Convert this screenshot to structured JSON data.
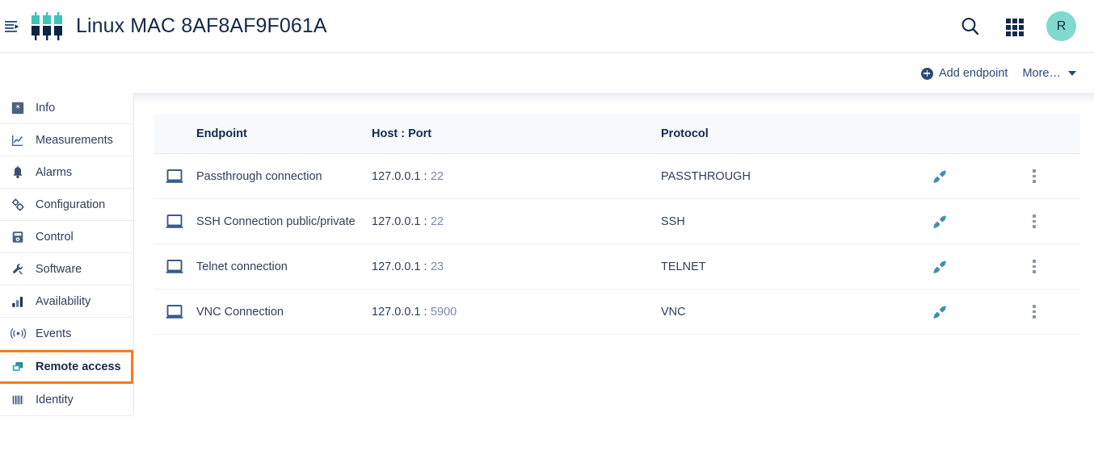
{
  "header": {
    "menu_icon": "hamburger-menu-icon",
    "logo_icon": "server-rack-logo",
    "title": "Linux MAC 8AF8AF9F061A",
    "search_icon": "search-icon",
    "apps_icon": "apps-grid-icon",
    "avatar_initial": "R"
  },
  "toolbar": {
    "add_endpoint_label": "Add endpoint",
    "add_icon": "plus-circle-icon",
    "more_label": "More…",
    "more_caret_icon": "chevron-down-icon"
  },
  "sidebar": {
    "items": [
      {
        "label": "Info",
        "icon": "info-asterisk-icon",
        "active": false
      },
      {
        "label": "Measurements",
        "icon": "line-chart-icon",
        "active": false
      },
      {
        "label": "Alarms",
        "icon": "bell-icon",
        "active": false
      },
      {
        "label": "Configuration",
        "icon": "gears-icon",
        "active": false
      },
      {
        "label": "Control",
        "icon": "control-panel-icon",
        "active": false
      },
      {
        "label": "Software",
        "icon": "wrench-screwdriver-icon",
        "active": false
      },
      {
        "label": "Availability",
        "icon": "bar-chart-icon",
        "active": false
      },
      {
        "label": "Events",
        "icon": "broadcast-signal-icon",
        "active": false
      },
      {
        "label": "Remote access",
        "icon": "remote-screens-icon",
        "active": true
      },
      {
        "label": "Identity",
        "icon": "barcode-icon",
        "active": false
      }
    ]
  },
  "table": {
    "columns": [
      "Endpoint",
      "Host : Port",
      "Protocol"
    ],
    "rows": [
      {
        "endpoint": "Passthrough connection",
        "icon": "laptop-icon",
        "host": "127.0.0.1 :",
        "port": "22",
        "protocol": "PASSTHROUGH",
        "action_icon": "plug-connect-icon",
        "menu_icon": "kebab-menu-icon"
      },
      {
        "endpoint": "SSH Connection public/private",
        "icon": "laptop-icon",
        "host": "127.0.0.1 :",
        "port": "22",
        "protocol": "SSH",
        "action_icon": "plug-connect-icon",
        "menu_icon": "kebab-menu-icon"
      },
      {
        "endpoint": "Telnet connection",
        "icon": "laptop-icon",
        "host": "127.0.0.1 :",
        "port": "23",
        "protocol": "TELNET",
        "action_icon": "plug-connect-icon",
        "menu_icon": "kebab-menu-icon"
      },
      {
        "endpoint": "VNC Connection",
        "icon": "laptop-icon",
        "host": "127.0.0.1 :",
        "port": "5900",
        "protocol": "VNC",
        "action_icon": "plug-connect-icon",
        "menu_icon": "kebab-menu-icon"
      }
    ]
  },
  "colors": {
    "brand_teal": "#3fc3b8",
    "brand_navy": "#0b2545",
    "accent_orange": "#f57c1f",
    "avatar_bg": "#7fd9ce",
    "text_navy": "#15294b",
    "port_gray": "#7b8aa3"
  }
}
